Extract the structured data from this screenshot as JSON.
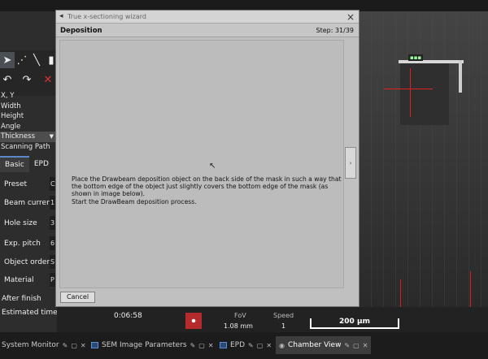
{
  "left_panel": {
    "properties": [
      "X, Y",
      "Width",
      "Height",
      "Angle",
      "Thickness",
      "Scanning Path"
    ],
    "tabs": [
      "Basic",
      "EPD"
    ],
    "fields": [
      {
        "label": "Preset",
        "value": "C"
      },
      {
        "label": "Beam current",
        "value": "1"
      },
      {
        "label": "Hole size",
        "value": "3"
      },
      {
        "label": "Exp. pitch",
        "value": "6"
      },
      {
        "label": "Object order",
        "value": "S"
      },
      {
        "label": "Material",
        "value": "P"
      }
    ],
    "after_finish": "After finish",
    "estimated_time_label": "Estimated time"
  },
  "status": {
    "estimated_time_value": "0:06:58",
    "fov_label": "FoV",
    "fov_value": "1.08 mm",
    "speed_label": "Speed",
    "speed_value": "1",
    "scale_bar": "200 µm"
  },
  "dialog": {
    "title": "True x-sectioning wizard",
    "close": "×",
    "step_title": "Deposition",
    "step_counter": "Step: 31/39",
    "instruction_1": "Place the Drawbeam deposition object on the back side of the mask in such a way that the bottom edge of the object just slightly covers the bottom edge of the mask (as shown in image below).",
    "instruction_2": "Start the DrawBeam deposition process.",
    "side_button": "›",
    "cancel": "Cancel"
  },
  "dock_tabs": [
    {
      "label": "System Monitor",
      "active": false
    },
    {
      "label": "SEM Image Parameters",
      "active": false
    },
    {
      "label": "EPD",
      "active": false
    },
    {
      "label": "Chamber View",
      "active": true
    }
  ],
  "colors": {
    "accent": "#5a88c8",
    "stop": "#b52a2a",
    "crosshair": "#e02020"
  }
}
